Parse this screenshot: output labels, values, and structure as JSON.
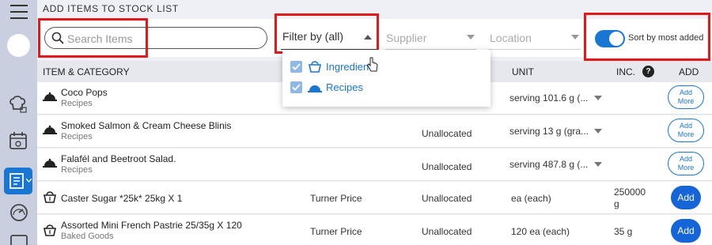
{
  "page": {
    "title": "ADD ITEMS TO STOCK LIST"
  },
  "sidebar": {
    "icons": [
      "menu-icon",
      "chef-hat-icon",
      "calendar-icon",
      "stock-list-icon",
      "gauge-icon",
      "printer-icon"
    ]
  },
  "toolbar": {
    "search_placeholder": "Search Items",
    "filter_label": "Filter by (all)",
    "supplier_placeholder": "Supplier",
    "location_placeholder": "Location",
    "sort_toggle_label": "Sort by most added",
    "sort_toggle_on": true
  },
  "filter_menu": {
    "options": [
      {
        "label": "Ingredients",
        "checked": true,
        "icon": "basket-icon"
      },
      {
        "label": "Recipes",
        "checked": true,
        "icon": "cloche-icon"
      }
    ]
  },
  "table": {
    "headers": {
      "item": "ITEM & CATEGORY",
      "unit": "UNIT",
      "inc": "INC.",
      "add": "ADD"
    },
    "rows": [
      {
        "name": "Coco Pops",
        "category": "Recipes",
        "supplier": "",
        "location": "",
        "unit": "serving 101.6 g (...",
        "inc": "",
        "add": "Add More",
        "add_style": "outline",
        "icon": "cloche-icon"
      },
      {
        "name": "Smoked Salmon & Cream Cheese Blinis",
        "category": "Recipes",
        "supplier": "",
        "location": "Unallocated",
        "unit": "serving 13 g (gra...",
        "inc": "",
        "add": "Add More",
        "add_style": "outline",
        "icon": "cloche-icon"
      },
      {
        "name": "Falafél and Beetroot Salad.",
        "category": "Recipes",
        "supplier": "",
        "location": "Unallocated",
        "unit": "serving 487.8 g (...",
        "inc": "",
        "add": "Add More",
        "add_style": "outline",
        "icon": "cloche-icon"
      },
      {
        "name": "Caster Sugar *25k* 25kg X 1",
        "category": "",
        "supplier": "Turner Price",
        "location": "Unallocated",
        "unit": "ea (each)",
        "inc": "250000 g",
        "add": "Add",
        "add_style": "filled",
        "icon": "basket-icon"
      },
      {
        "name": "Assorted Mini French Pastrie 25/35g X 120",
        "category": "Baked Goods",
        "supplier": "Turner Price",
        "location": "Unallocated",
        "unit": "120 ea (each)",
        "inc": "35 g",
        "add": "Add",
        "add_style": "filled",
        "icon": "basket-icon"
      }
    ]
  },
  "colors": {
    "accent": "#1976d2",
    "highlight_box": "#e01919",
    "sidebar": "#c9cfdf"
  }
}
